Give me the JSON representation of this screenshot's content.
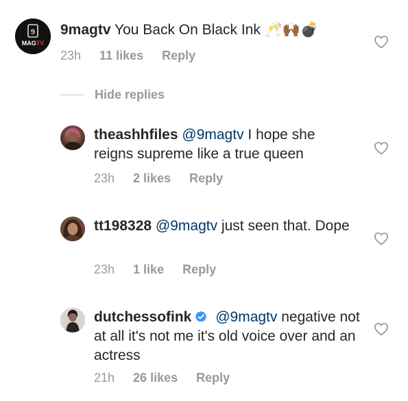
{
  "comments": [
    {
      "username": "9magtv",
      "text": "You Back On Black Ink",
      "emoji": "🥂🙌🏾💣",
      "time": "23h",
      "likes": "11 likes",
      "reply": "Reply",
      "avatar_label": "MAG TV"
    },
    {
      "username": "theashhfiles",
      "mention": "@9magtv",
      "text": "I hope she reigns supreme like a true queen",
      "time": "23h",
      "likes": "2 likes",
      "reply": "Reply"
    },
    {
      "username": "tt198328",
      "mention": "@9magtv",
      "text": "just seen that. Dope",
      "time": "23h",
      "likes": "1 like",
      "reply": "Reply"
    },
    {
      "username": "dutchessofink",
      "mention": "@9magtv",
      "text": "negative not at all it's not me it's old voice over and an actress",
      "time": "21h",
      "likes": "26 likes",
      "reply": "Reply"
    }
  ],
  "hide_replies": "Hide replies",
  "colors": {
    "mention": "#003569",
    "meta": "#999999",
    "verified": "#3897f0"
  },
  "icons": {
    "like": "heart-outline-icon",
    "verified": "verified-badge-icon"
  }
}
